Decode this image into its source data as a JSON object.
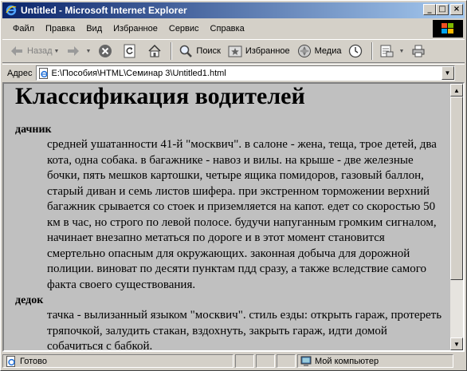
{
  "window": {
    "title": "Untitled - Microsoft Internet Explorer",
    "minimize": "_",
    "maximize": "□",
    "close": "×"
  },
  "menu": [
    "Файл",
    "Правка",
    "Вид",
    "Избранное",
    "Сервис",
    "Справка"
  ],
  "toolbar": {
    "back_label": "Назад",
    "search_label": "Поиск",
    "favorites_label": "Избранное",
    "media_label": "Медиа"
  },
  "address": {
    "label": "Адрес",
    "value": "E:\\Пособия\\HTML\\Семинар 3\\Untitled1.html"
  },
  "page": {
    "heading": "Классификация водителей",
    "terms": [
      {
        "term": "дачник",
        "definition": "средней ушатанности 41-й \"москвич\". в салоне - жена, теща, трое детей, два кота, одна собака. в багажнике - навоз и вилы. на крыше - две железные бочки, пять мешков картошки, четыре ящика помидоров, газовый баллон, старый диван и семь листов шифера. при экстренном торможении верхний багажник срывается со стоек и приземляется на капот. едет со скоростью 50 км в час, но строго по левой полосе. будучи напуганным громким сигналом, начинает внезапно метаться по дороге и в этот момент становится смертельно опасным для окружающих. законная добыча для дорожной полиции. виноват по десяти пунктам пдд сразу, а также вследствие самого факта своего существования."
      },
      {
        "term": "дедок",
        "definition": "тачка - вылизанный языком \"москвич\". стиль езды: открыть гараж, протереть тряпочкой, залудить стакан, вздохнуть, закрыть гараж, идти домой собачиться с бабкой."
      }
    ]
  },
  "status": {
    "text": "Готово",
    "zone": "Мой компьютер"
  },
  "colors": {
    "title_gradient_start": "#0a246a",
    "title_gradient_end": "#a6caf0",
    "page_background": "#c0c0c0",
    "chrome": "#d4d0c8"
  }
}
